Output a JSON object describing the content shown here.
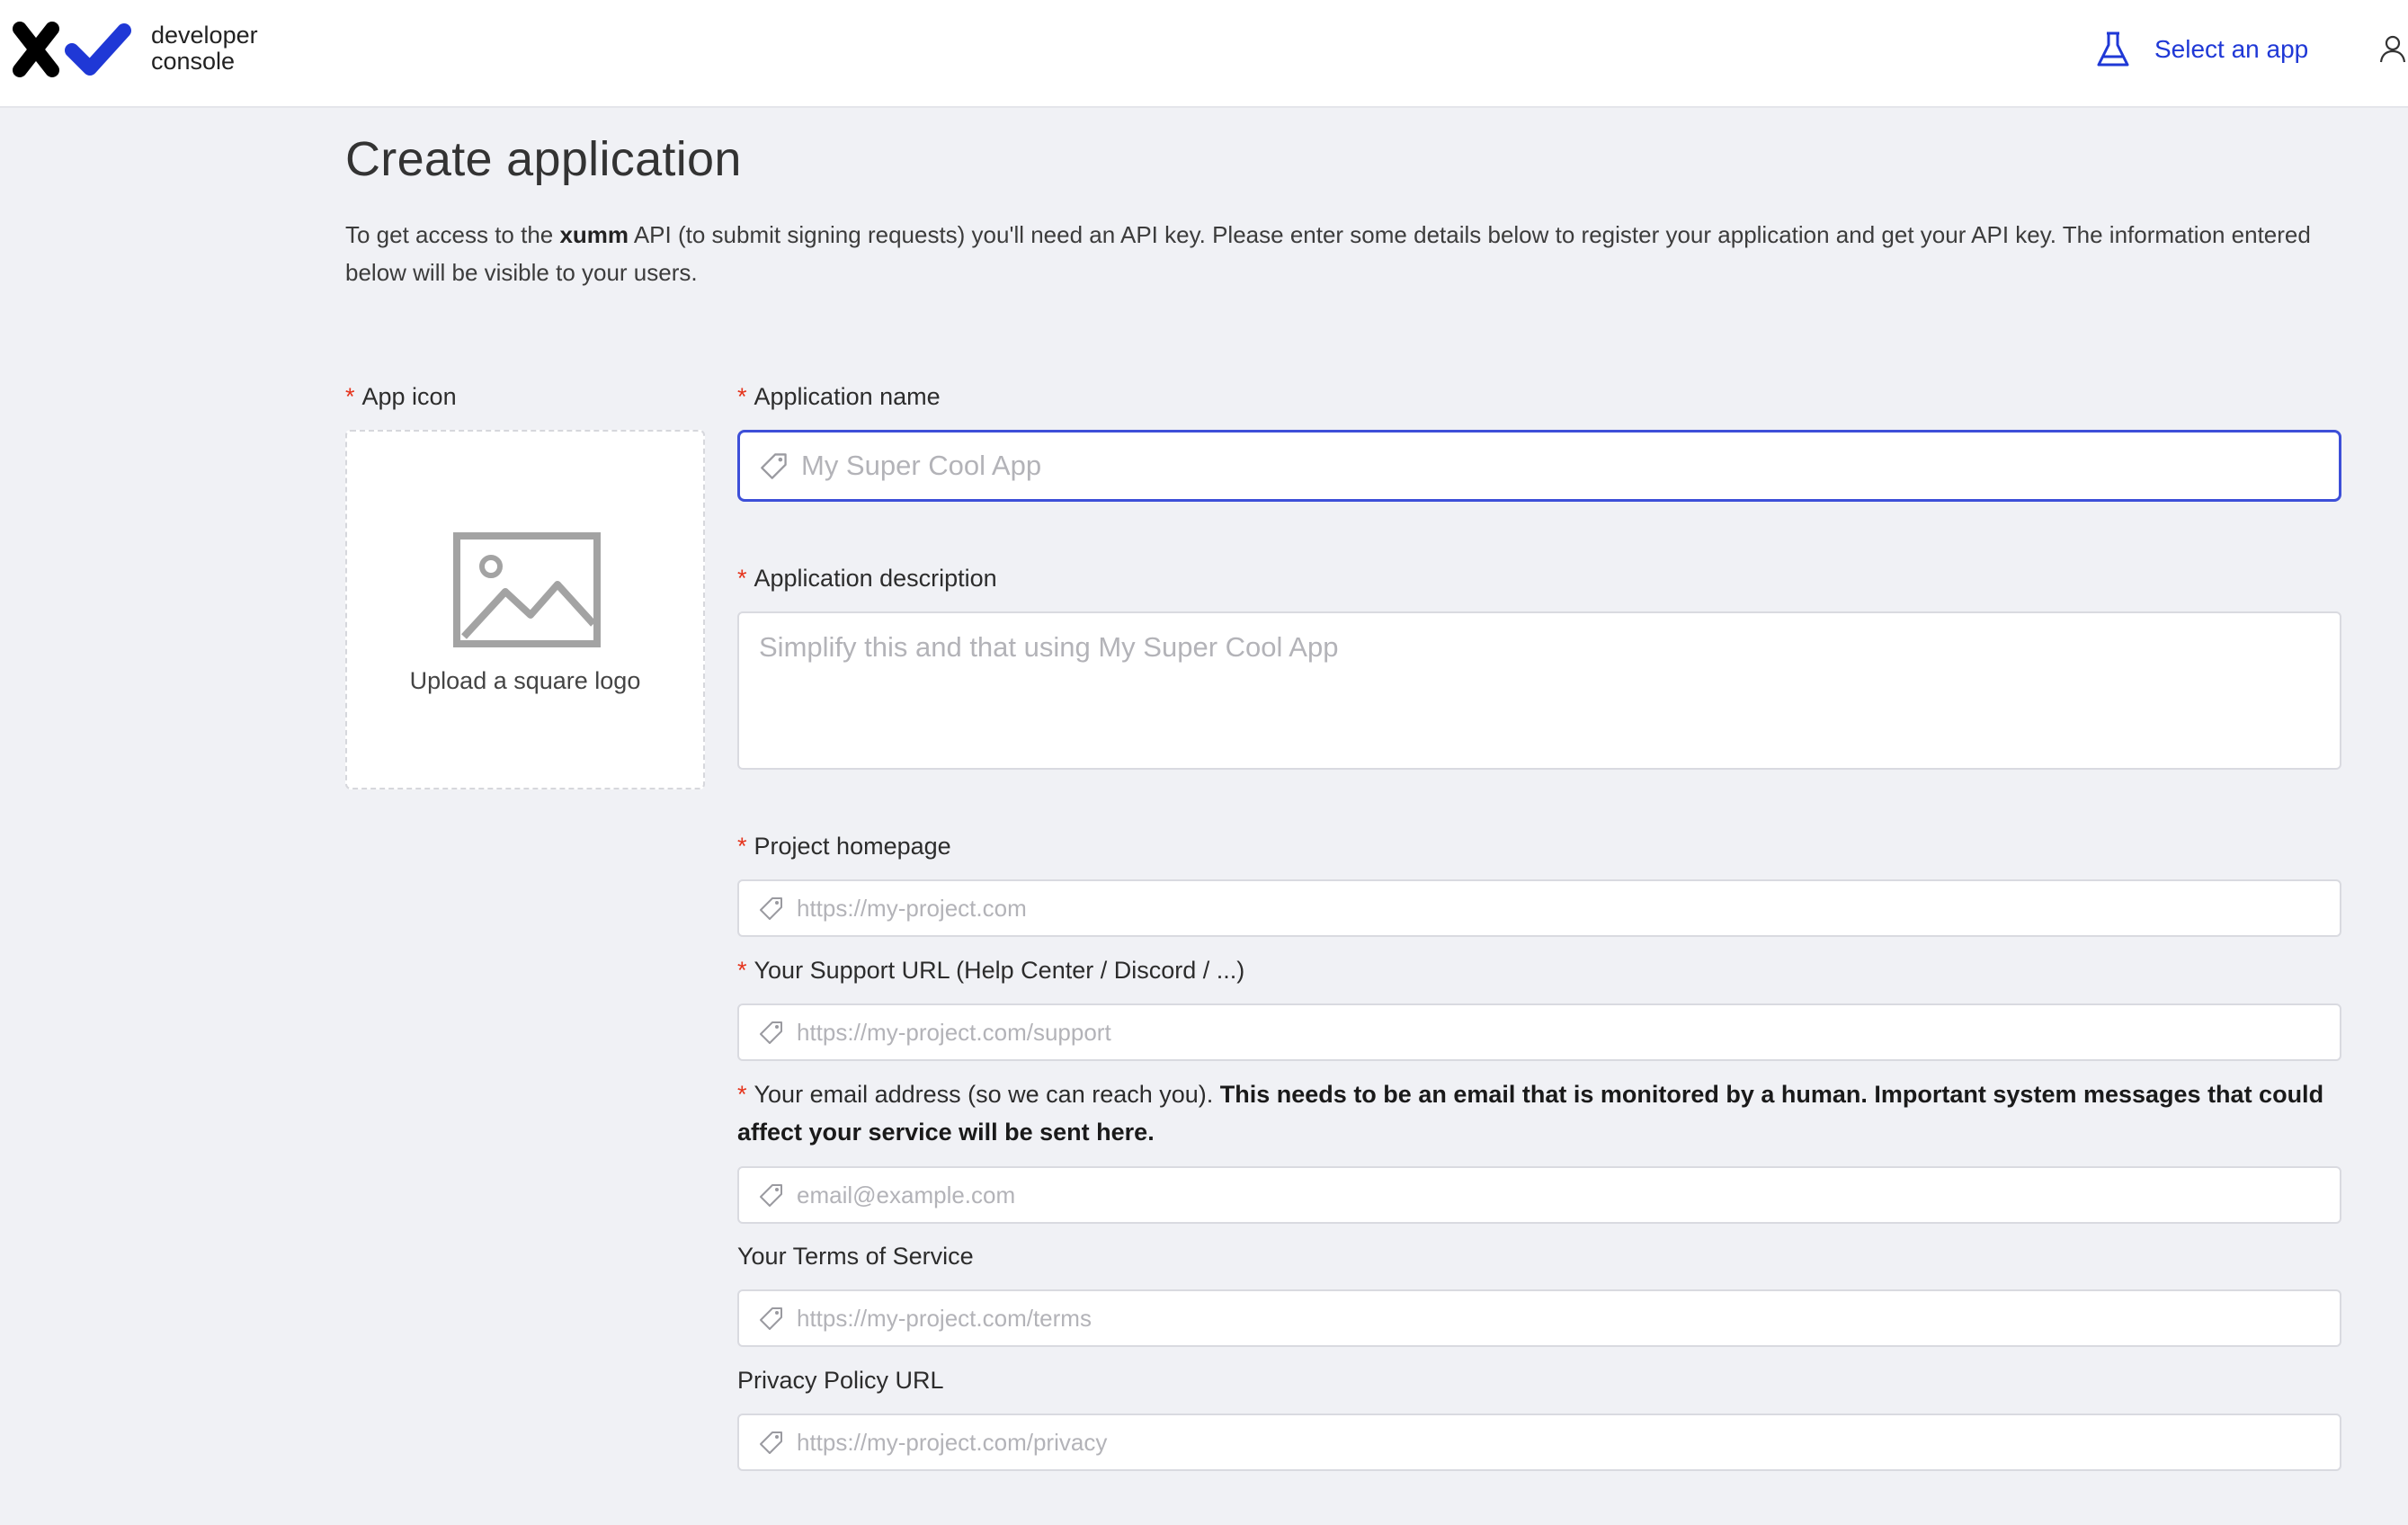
{
  "header": {
    "logo_line1": "developer",
    "logo_line2": "console",
    "select_app_label": "Select an app",
    "accent_color": "#1f38d6"
  },
  "page": {
    "title": "Create application",
    "intro_part1": "To get access to the ",
    "intro_bold": "xumm",
    "intro_part2": " API (to submit signing requests) you'll need an API key. Please enter some details below to register your application and get your API key. The information entered below will be visible to your users."
  },
  "form": {
    "required_marker": "*",
    "app_icon": {
      "label": "App icon",
      "upload_text": "Upload a square logo"
    },
    "application_name": {
      "label": "Application name",
      "placeholder": "My Super Cool App",
      "value": ""
    },
    "application_description": {
      "label": "Application description",
      "placeholder": "Simplify this and that using My Super Cool App",
      "value": ""
    },
    "project_homepage": {
      "label": "Project homepage",
      "placeholder": "https://my-project.com",
      "value": ""
    },
    "support_url": {
      "label": "Your Support URL (Help Center / Discord / ...)",
      "placeholder": "https://my-project.com/support",
      "value": ""
    },
    "email": {
      "label": "Your email address (so we can reach you). ",
      "label_bold": "This needs to be an email that is monitored by a human. Important system messages that could affect your service will be sent here.",
      "placeholder": "email@example.com",
      "value": ""
    },
    "terms": {
      "label": "Your Terms of Service",
      "placeholder": "https://my-project.com/terms",
      "value": ""
    },
    "privacy": {
      "label": "Privacy Policy URL",
      "placeholder": "https://my-project.com/privacy",
      "value": ""
    }
  },
  "icons": {
    "logo": "xumm-logo-icon",
    "select_app": "flask-icon",
    "user": "user-icon",
    "upload": "image-placeholder-icon",
    "input_prefix": "tag-icon"
  },
  "colors": {
    "required": "#e5341c",
    "focus_border": "#3d4fd8",
    "background": "#f0f1f5"
  }
}
